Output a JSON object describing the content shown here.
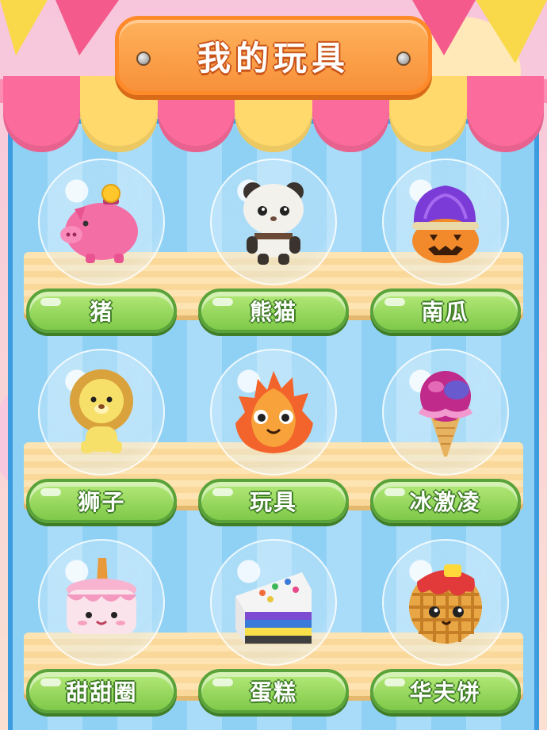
{
  "header": {
    "title": "我的玩具"
  },
  "colors": {
    "sign": "#f7913a",
    "button": "#7fc94a",
    "shop_wall": "#8fd1f5",
    "awning_pink": "#fb6b9c",
    "awning_yellow": "#ffd96b"
  },
  "toys": [
    {
      "label": "猪",
      "icon": "piggy-bank-icon"
    },
    {
      "label": "熊猫",
      "icon": "panda-icon"
    },
    {
      "label": "南瓜",
      "icon": "pumpkin-icon"
    },
    {
      "label": "狮子",
      "icon": "lion-icon"
    },
    {
      "label": "玩具",
      "icon": "flame-plush-icon"
    },
    {
      "label": "冰激凌",
      "icon": "ice-cream-icon"
    },
    {
      "label": "甜甜圈",
      "icon": "cake-icon"
    },
    {
      "label": "蛋糕",
      "icon": "cake-slice-icon"
    },
    {
      "label": "华夫饼",
      "icon": "waffle-icon"
    }
  ]
}
